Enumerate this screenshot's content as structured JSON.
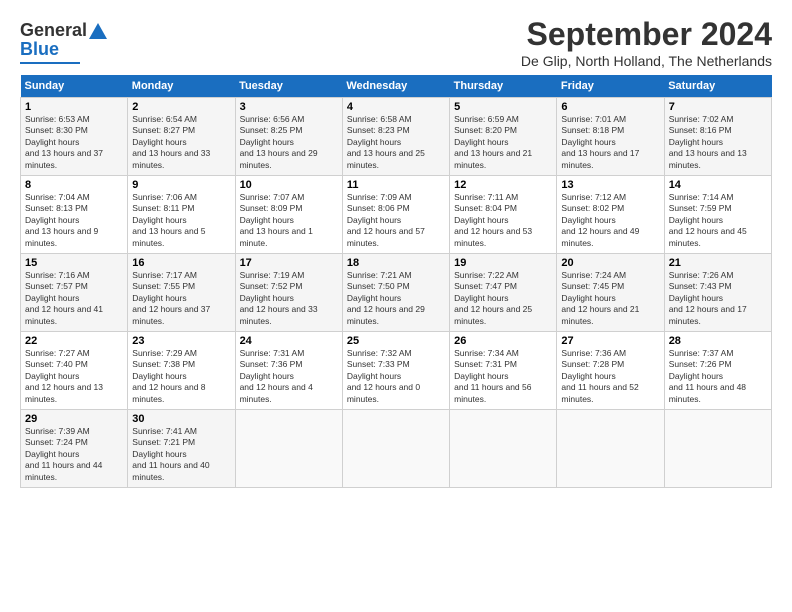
{
  "header": {
    "logo_line1": "General",
    "logo_line2": "Blue",
    "month": "September 2024",
    "location": "De Glip, North Holland, The Netherlands"
  },
  "weekdays": [
    "Sunday",
    "Monday",
    "Tuesday",
    "Wednesday",
    "Thursday",
    "Friday",
    "Saturday"
  ],
  "weeks": [
    [
      {
        "num": "1",
        "rise": "6:53 AM",
        "set": "8:30 PM",
        "daylight": "13 hours and 37 minutes."
      },
      {
        "num": "2",
        "rise": "6:54 AM",
        "set": "8:27 PM",
        "daylight": "13 hours and 33 minutes."
      },
      {
        "num": "3",
        "rise": "6:56 AM",
        "set": "8:25 PM",
        "daylight": "13 hours and 29 minutes."
      },
      {
        "num": "4",
        "rise": "6:58 AM",
        "set": "8:23 PM",
        "daylight": "13 hours and 25 minutes."
      },
      {
        "num": "5",
        "rise": "6:59 AM",
        "set": "8:20 PM",
        "daylight": "13 hours and 21 minutes."
      },
      {
        "num": "6",
        "rise": "7:01 AM",
        "set": "8:18 PM",
        "daylight": "13 hours and 17 minutes."
      },
      {
        "num": "7",
        "rise": "7:02 AM",
        "set": "8:16 PM",
        "daylight": "13 hours and 13 minutes."
      }
    ],
    [
      {
        "num": "8",
        "rise": "7:04 AM",
        "set": "8:13 PM",
        "daylight": "13 hours and 9 minutes."
      },
      {
        "num": "9",
        "rise": "7:06 AM",
        "set": "8:11 PM",
        "daylight": "13 hours and 5 minutes."
      },
      {
        "num": "10",
        "rise": "7:07 AM",
        "set": "8:09 PM",
        "daylight": "13 hours and 1 minute."
      },
      {
        "num": "11",
        "rise": "7:09 AM",
        "set": "8:06 PM",
        "daylight": "12 hours and 57 minutes."
      },
      {
        "num": "12",
        "rise": "7:11 AM",
        "set": "8:04 PM",
        "daylight": "12 hours and 53 minutes."
      },
      {
        "num": "13",
        "rise": "7:12 AM",
        "set": "8:02 PM",
        "daylight": "12 hours and 49 minutes."
      },
      {
        "num": "14",
        "rise": "7:14 AM",
        "set": "7:59 PM",
        "daylight": "12 hours and 45 minutes."
      }
    ],
    [
      {
        "num": "15",
        "rise": "7:16 AM",
        "set": "7:57 PM",
        "daylight": "12 hours and 41 minutes."
      },
      {
        "num": "16",
        "rise": "7:17 AM",
        "set": "7:55 PM",
        "daylight": "12 hours and 37 minutes."
      },
      {
        "num": "17",
        "rise": "7:19 AM",
        "set": "7:52 PM",
        "daylight": "12 hours and 33 minutes."
      },
      {
        "num": "18",
        "rise": "7:21 AM",
        "set": "7:50 PM",
        "daylight": "12 hours and 29 minutes."
      },
      {
        "num": "19",
        "rise": "7:22 AM",
        "set": "7:47 PM",
        "daylight": "12 hours and 25 minutes."
      },
      {
        "num": "20",
        "rise": "7:24 AM",
        "set": "7:45 PM",
        "daylight": "12 hours and 21 minutes."
      },
      {
        "num": "21",
        "rise": "7:26 AM",
        "set": "7:43 PM",
        "daylight": "12 hours and 17 minutes."
      }
    ],
    [
      {
        "num": "22",
        "rise": "7:27 AM",
        "set": "7:40 PM",
        "daylight": "12 hours and 13 minutes."
      },
      {
        "num": "23",
        "rise": "7:29 AM",
        "set": "7:38 PM",
        "daylight": "12 hours and 8 minutes."
      },
      {
        "num": "24",
        "rise": "7:31 AM",
        "set": "7:36 PM",
        "daylight": "12 hours and 4 minutes."
      },
      {
        "num": "25",
        "rise": "7:32 AM",
        "set": "7:33 PM",
        "daylight": "12 hours and 0 minutes."
      },
      {
        "num": "26",
        "rise": "7:34 AM",
        "set": "7:31 PM",
        "daylight": "11 hours and 56 minutes."
      },
      {
        "num": "27",
        "rise": "7:36 AM",
        "set": "7:28 PM",
        "daylight": "11 hours and 52 minutes."
      },
      {
        "num": "28",
        "rise": "7:37 AM",
        "set": "7:26 PM",
        "daylight": "11 hours and 48 minutes."
      }
    ],
    [
      {
        "num": "29",
        "rise": "7:39 AM",
        "set": "7:24 PM",
        "daylight": "11 hours and 44 minutes."
      },
      {
        "num": "30",
        "rise": "7:41 AM",
        "set": "7:21 PM",
        "daylight": "11 hours and 40 minutes."
      },
      null,
      null,
      null,
      null,
      null
    ]
  ]
}
